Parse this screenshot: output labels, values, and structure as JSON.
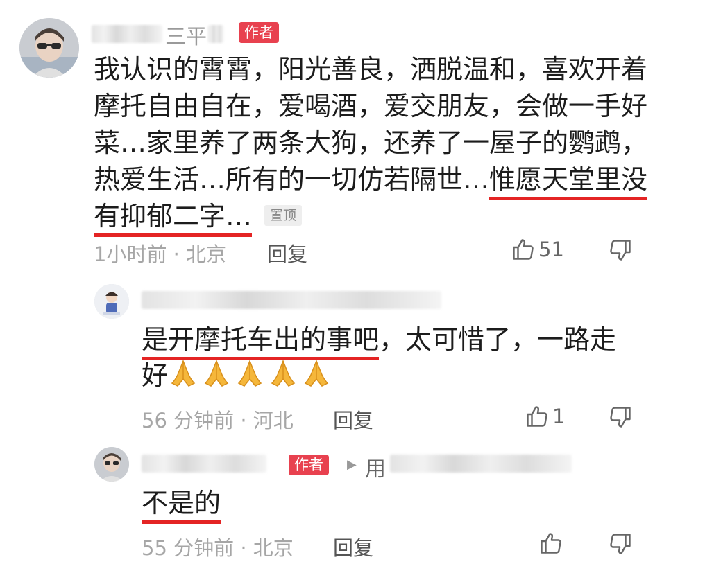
{
  "main_comment": {
    "name_fragment": "三平",
    "author_tag": "作者",
    "text_plain": "我认识的霄霄，阳光善良，洒脱温和，喜欢开着摩托自由自在，爱喝酒，爱交朋友，会做一手好菜…家里养了两条大狗，还养了一屋子的鹦鹉，热爱生活…所有的一切仿若隔世…",
    "text_underlined": "惟愿天堂里没有抑郁二字…",
    "pin_label": "置顶",
    "time_location": "1小时前 · 北京",
    "reply_label": "回复",
    "like_count": "51"
  },
  "reply_1": {
    "text_underlined": "是开摩托车出的事吧",
    "text_rest": "，太可惜了，一路走好",
    "time_location": "56 分钟前 · 河北",
    "reply_label": "回复",
    "like_count": "1",
    "emoji": "folded-hands"
  },
  "reply_2": {
    "author_tag": "作者",
    "reply_to_fragment": "用",
    "text_underlined": "不是的",
    "time_location": "55 分钟前 · 北京",
    "reply_label": "回复",
    "like_count": ""
  },
  "colors": {
    "author_tag": "#e8414f",
    "underline": "#e42424",
    "meta_text": "#a6a6a6"
  }
}
